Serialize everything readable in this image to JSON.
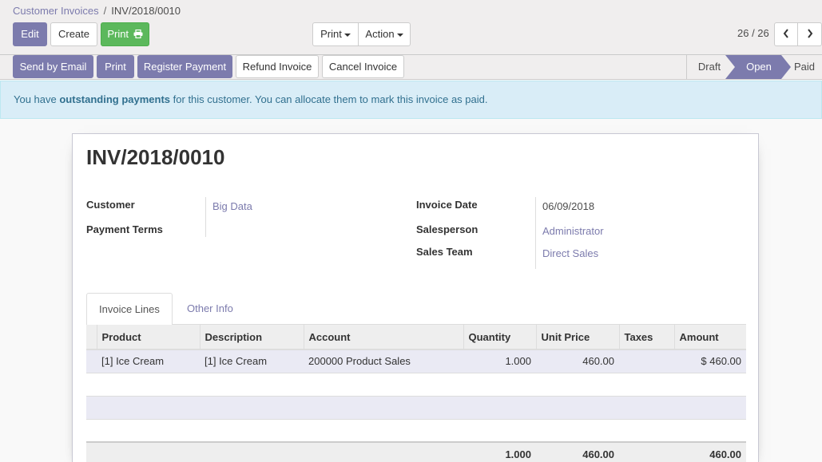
{
  "breadcrumb": {
    "parent": "Customer Invoices",
    "separator": "/",
    "current": "INV/2018/0010"
  },
  "toolbar": {
    "edit_label": "Edit",
    "create_label": "Create",
    "print_label": "Print",
    "print_dropdown_label": "Print",
    "action_dropdown_label": "Action"
  },
  "pager": {
    "value": "26 / 26"
  },
  "statusbar": {
    "buttons": {
      "send_by_email": "Send by Email",
      "print": "Print",
      "register_payment": "Register Payment",
      "refund_invoice": "Refund Invoice",
      "cancel_invoice": "Cancel Invoice"
    },
    "stages": [
      "Draft",
      "Open",
      "Paid"
    ],
    "active_stage": "Open"
  },
  "alert": {
    "prefix": "You have ",
    "bold": "outstanding payments",
    "suffix": " for this customer. You can allocate them to mark this invoice as paid."
  },
  "invoice": {
    "number": "INV/2018/0010",
    "fields": {
      "customer_label": "Customer",
      "customer_value": "Big Data",
      "payment_terms_label": "Payment Terms",
      "payment_terms_value": "",
      "invoice_date_label": "Invoice Date",
      "invoice_date_value": "06/09/2018",
      "salesperson_label": "Salesperson",
      "salesperson_value": "Administrator",
      "sales_team_label": "Sales Team",
      "sales_team_value": "Direct Sales"
    }
  },
  "tabs": [
    "Invoice Lines",
    "Other Info"
  ],
  "lines": {
    "headers": [
      "Product",
      "Description",
      "Account",
      "Quantity",
      "Unit Price",
      "Taxes",
      "Amount"
    ],
    "rows": [
      [
        "[1] Ice Cream",
        "[1] Ice Cream",
        "200000 Product Sales",
        "1.000",
        "460.00",
        "",
        "$ 460.00"
      ]
    ],
    "totals": {
      "quantity": "1.000",
      "unit_price": "460.00",
      "amount": "460.00"
    }
  },
  "colors": {
    "primary": "#7c7bad",
    "success": "#5cb85c",
    "alert_bg": "#d9edf7",
    "alert_text": "#31708f",
    "active_stage": "#7c7bad"
  },
  "icons": {
    "print": "printer-icon",
    "prev": "chevron-left-icon",
    "next": "chevron-right-icon"
  }
}
